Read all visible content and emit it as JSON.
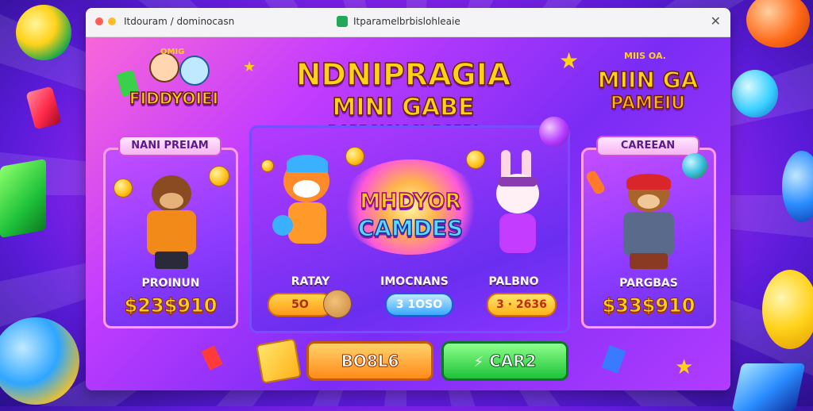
{
  "colors": {
    "accent_orange": "#ff9f1a",
    "accent_green": "#3fd14a",
    "accent_blue": "#3aa7ff",
    "title_yellow": "#ffd21a"
  },
  "window": {
    "tab_left": "Itdouram / dominocasn",
    "tab_center": "Itparamelbrbislohleaie",
    "close_glyph": "✕"
  },
  "header": {
    "title": "NDNIPRAGIA",
    "subtitle": "MINI GABE",
    "tagline": "DORBOIOIOCL DOPB!"
  },
  "left_logo": {
    "top": "OMIG",
    "main": "FIDDYOIEI"
  },
  "right_logo": {
    "top": "MIIS OA.",
    "main": "MIIN GA",
    "sub": "PAMEIU"
  },
  "left_panel": {
    "pill": "NANI PREIAM",
    "label": "PROINUN",
    "price": "$23$910"
  },
  "center_panel": {
    "center_logo_top": "MHDYOR",
    "center_logo_bottom": "CAMDES",
    "items": [
      {
        "label": "RATAY",
        "badge": "5O"
      },
      {
        "label": "IMOCNANS",
        "badge": "3 1OSO"
      },
      {
        "label": "PALBNO",
        "badge": "3 · 2636"
      }
    ]
  },
  "right_panel": {
    "pill": "CAREEAN",
    "label": "PARGBAS",
    "price": "$33$910"
  },
  "buttons": {
    "left": "BO8L6",
    "right": "CAR2",
    "right_icon": "⚡"
  },
  "icons": [
    "bear-left-character",
    "fox-character",
    "bunny-character",
    "bear-right-character",
    "coin-icon",
    "cookie-icon",
    "box-icon",
    "lightning-icon",
    "star-icon"
  ]
}
